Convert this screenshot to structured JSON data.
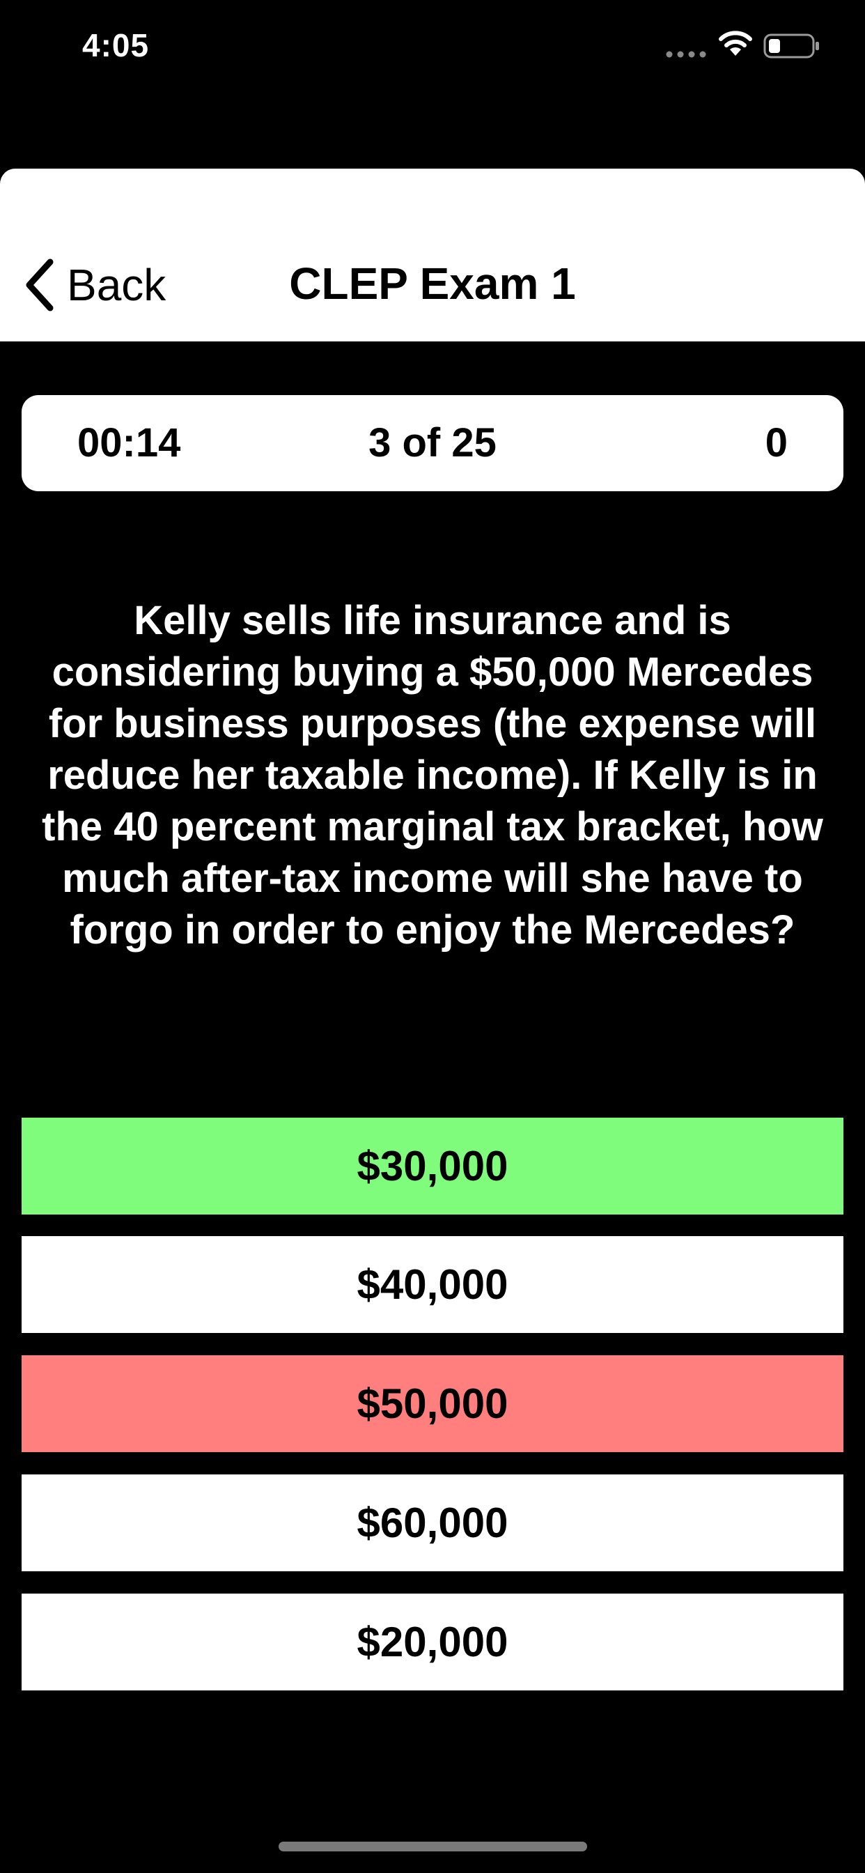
{
  "status_bar": {
    "time": "4:05",
    "icons": [
      "signal-dots-icon",
      "wifi-icon",
      "battery-icon"
    ]
  },
  "nav": {
    "back_label": "Back",
    "title": "CLEP Exam 1"
  },
  "info": {
    "timer": "00:14",
    "progress": "3 of 25",
    "score": "0"
  },
  "question": {
    "text": "Kelly sells life insurance and is considering buying a $50,000 Mercedes for business purposes (the expense will reduce her taxable income). If Kelly is in the 40 percent marginal tax bracket, how much after-tax income will she have to forgo in order to enjoy the Mercedes?"
  },
  "answers": [
    {
      "label": "$30,000",
      "state": "correct"
    },
    {
      "label": "$40,000",
      "state": "neutral"
    },
    {
      "label": "$50,000",
      "state": "incorrect"
    },
    {
      "label": "$60,000",
      "state": "neutral"
    },
    {
      "label": "$20,000",
      "state": "neutral"
    }
  ],
  "colors": {
    "background": "#000000",
    "correct": "#80FC7C",
    "incorrect": "#FF7F7F",
    "neutral": "#FFFFFF",
    "text_dark": "#000000",
    "text_light": "#FFFFFF"
  }
}
